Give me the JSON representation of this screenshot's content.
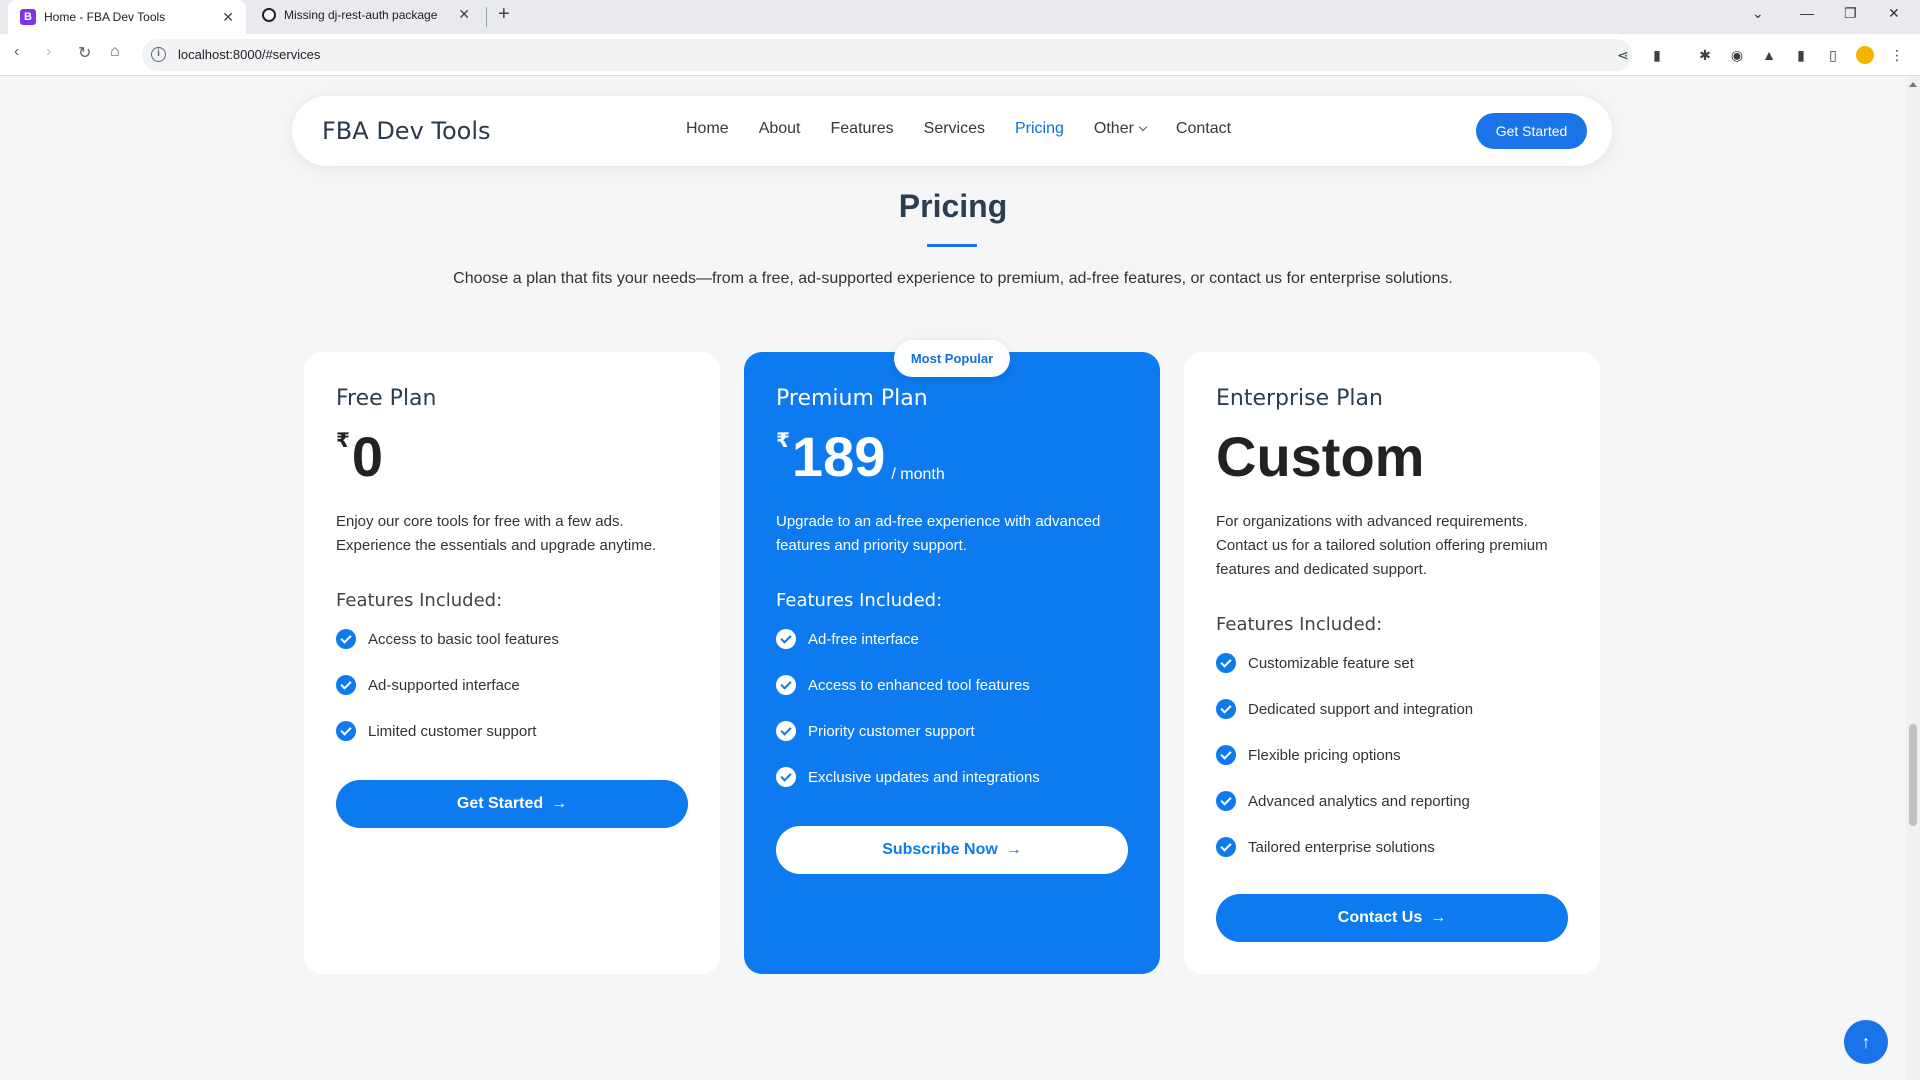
{
  "browser": {
    "tabs": [
      {
        "title": "Home - FBA Dev Tools",
        "favicon": "B",
        "favicon_color": "#7b35e8"
      },
      {
        "title": "Missing dj-rest-auth package",
        "favicon": "",
        "favicon_color": "#202124"
      }
    ],
    "url": "localhost:8000/#services"
  },
  "header": {
    "logo": "FBA Dev Tools",
    "nav": [
      "Home",
      "About",
      "Features",
      "Services",
      "Pricing",
      "Other",
      "Contact"
    ],
    "active": "Pricing",
    "cta": "Get Started"
  },
  "pricing": {
    "title": "Pricing",
    "subtitle": "Choose a plan that fits your needs—from a free, ad-supported experience to premium, ad-free features, or contact us for enterprise solutions.",
    "plans": [
      {
        "name": "Free Plan",
        "currency": "₹",
        "price": "0",
        "period": "",
        "description": "Enjoy our core tools for free with a few ads. Experience the essentials and upgrade anytime.",
        "features_heading": "Features Included:",
        "features": [
          "Access to basic tool features",
          "Ad-supported interface",
          "Limited customer support"
        ],
        "button": "Get Started"
      },
      {
        "name": "Premium Plan",
        "badge": "Most Popular",
        "currency": "₹",
        "price": "189",
        "period": "/ month",
        "description": "Upgrade to an ad-free experience with advanced features and priority support.",
        "features_heading": "Features Included:",
        "features": [
          "Ad-free interface",
          "Access to enhanced tool features",
          "Priority customer support",
          "Exclusive updates and integrations"
        ],
        "button": "Subscribe Now"
      },
      {
        "name": "Enterprise Plan",
        "currency": "",
        "price": "Custom",
        "period": "",
        "description": "For organizations with advanced requirements. Contact us for a tailored solution offering premium features and dedicated support.",
        "features_heading": "Features Included:",
        "features": [
          "Customizable feature set",
          "Dedicated support and integration",
          "Flexible pricing options",
          "Advanced analytics and reporting",
          "Tailored enterprise solutions"
        ],
        "button": "Contact Us"
      }
    ]
  },
  "colors": {
    "accent": "#0d7af0",
    "page_bg": "#f4f6f8",
    "card_bg": "#ffffff"
  }
}
